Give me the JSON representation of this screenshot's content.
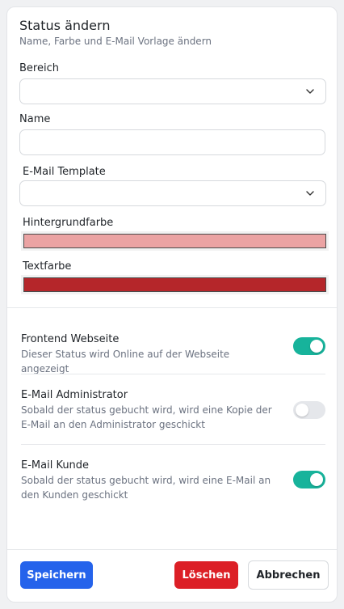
{
  "header": {
    "title": "Status ändern",
    "subtitle": "Name, Farbe und E-Mail Vorlage ändern"
  },
  "form": {
    "bereich": {
      "label": "Bereich",
      "value": ""
    },
    "name": {
      "label": "Name",
      "value": ""
    },
    "email_template": {
      "label": "E-Mail Template",
      "value": ""
    },
    "hintergrundfarbe": {
      "label": "Hintergrundfarbe",
      "color": "#eba3a3"
    },
    "textfarbe": {
      "label": "Textfarbe",
      "color": "#b5262a"
    }
  },
  "options": [
    {
      "title": "Frontend Webseite",
      "description": "Dieser Status wird Online auf der Webseite angezeigt",
      "enabled": true
    },
    {
      "title": "E-Mail Administrator",
      "description": "Sobald der status gebucht wird, wird eine Kopie der E-Mail an den Administrator geschickt",
      "enabled": false
    },
    {
      "title": "E-Mail Kunde",
      "description": "Sobald der status gebucht wird, wird eine E-Mail an den Kunden geschickt",
      "enabled": true
    }
  ],
  "footer": {
    "save_label": "Speichern",
    "delete_label": "Löschen",
    "cancel_label": "Abbrechen"
  },
  "colors": {
    "primary": "#2563eb",
    "danger": "#dc1f26",
    "toggle_on": "#17b39b",
    "toggle_off": "#e5e7eb"
  },
  "icons": {
    "select_chevron": "chevron-down-icon"
  }
}
